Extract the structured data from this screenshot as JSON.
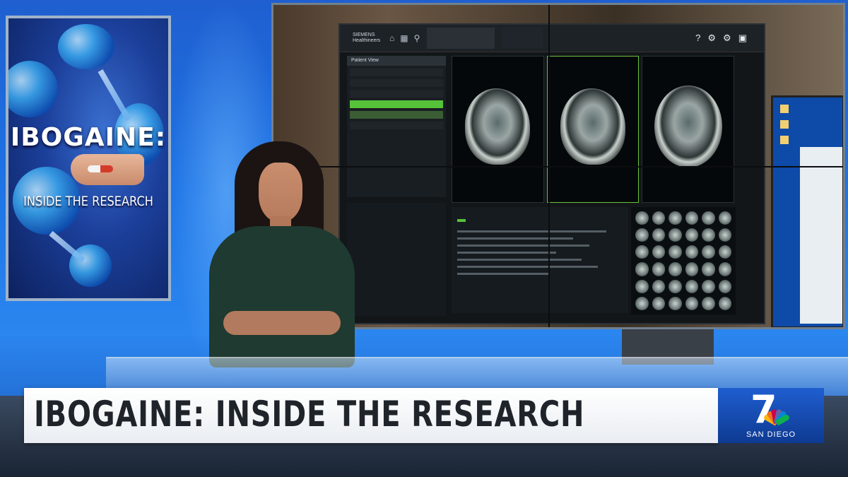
{
  "poster": {
    "title": "IBOGAINE:",
    "subtitle": "INSIDE THE RESEARCH"
  },
  "lower_third": {
    "headline": "IBOGAINE: INSIDE THE RESEARCH"
  },
  "logo": {
    "number": "7",
    "city": "SAN DIEGO"
  },
  "monitor_app": {
    "brand": "SIEMENS Healthineers",
    "panel_title": "Patient View"
  },
  "colors": {
    "studio_blue": "#1e74e6",
    "lower_third_bg": "#ffffff",
    "lower_third_text": "#1f232a",
    "logo_blue": "#1f5ed0",
    "app_accent_green": "#56c23a"
  }
}
